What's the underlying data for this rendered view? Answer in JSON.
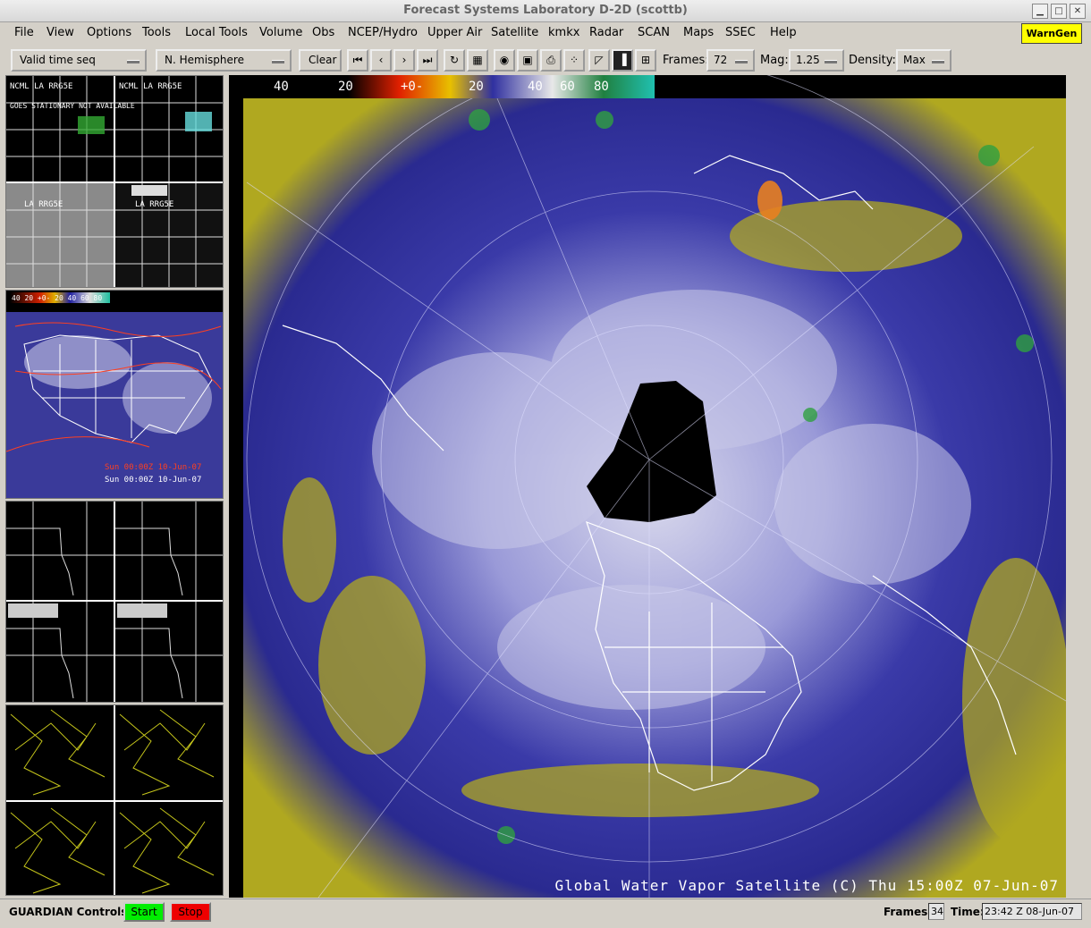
{
  "window": {
    "title": "Forecast Systems Laboratory D-2D (scottb)"
  },
  "menu": {
    "items": [
      "File",
      "View",
      "Options",
      "Tools",
      "Local Tools",
      "Volume",
      "Obs",
      "NCEP/Hydro",
      "Upper Air",
      "Satellite",
      "kmkx",
      "Radar",
      "SCAN",
      "Maps",
      "SSEC",
      "Help"
    ],
    "warngen": "WarnGen"
  },
  "toolbar": {
    "time_seq": "Valid time seq",
    "projection": "N. Hemisphere",
    "clear": "Clear",
    "frames_label": "Frames:",
    "frames_value": "72",
    "mag_label": "Mag:",
    "mag_value": "1.25",
    "density_label": "Density:",
    "density_value": "Max"
  },
  "panels": {
    "p1_labels": [
      "NCML LA RRG5E",
      "NCML LA RRG5E"
    ],
    "p1_note": "GOES STATIONARY NOT AVAILABLE",
    "p1_sub": [
      "LA RRG5E",
      "LA RRG5E"
    ],
    "p2_colorbar": "40 20 +0- 20 40 60 80",
    "p2_time1": "Sun 00:00Z 10-Jun-07",
    "p2_time2": "Sun 00:00Z 10-Jun-07"
  },
  "main": {
    "colorbar_ticks": [
      "40",
      "20",
      "+0-",
      "20",
      "40",
      "60",
      "80"
    ],
    "title": "Global Water Vapor Satellite (C)  Thu 15:00Z 07-Jun-07"
  },
  "status": {
    "guardian_label": "GUARDIAN Controls:",
    "start": "Start",
    "stop": "Stop",
    "frames_label": "Frames:",
    "frames_value": "34",
    "time_label": "Time:",
    "time_value": "23:42 Z 08-Jun-07"
  },
  "colors": {
    "start": "#00ee00",
    "stop": "#ee0000",
    "warngen": "#ffff00"
  }
}
